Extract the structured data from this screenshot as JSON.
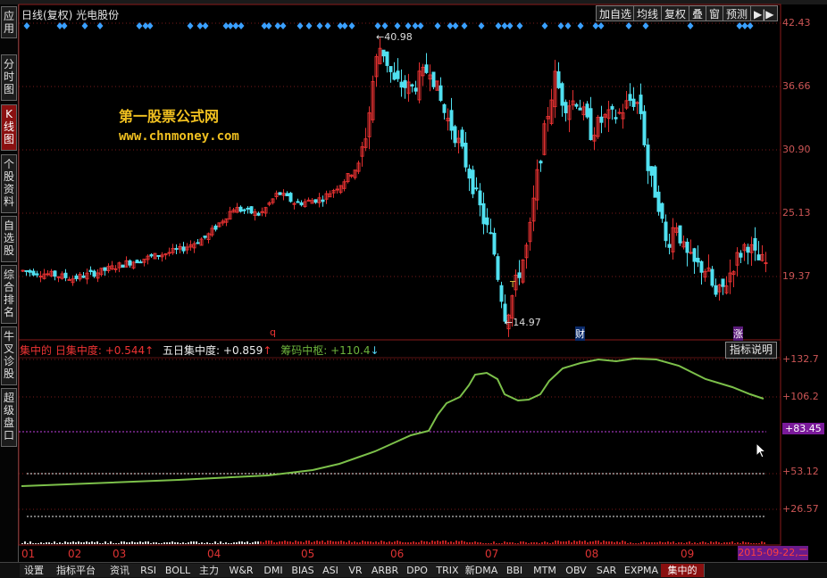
{
  "header": {
    "title": "日线(复权) 光电股份",
    "buttons": [
      "加自选",
      "均线",
      "复权",
      "叠",
      "窗",
      "预测",
      "▶|▶"
    ]
  },
  "sidebar": {
    "tabs": [
      "应用",
      "分时图",
      "K线图",
      "个股资料",
      "自选股",
      "综合排名",
      "牛叉诊股",
      "超级盘口"
    ],
    "active_index": 2
  },
  "watermark": {
    "line1": "第一股票公式网",
    "line2": "www.chnmoney.com"
  },
  "price_axis": [
    "42.43",
    "36.66",
    "30.90",
    "25.13",
    "19.37"
  ],
  "price_markers": {
    "high": "40.98",
    "low": "14.97"
  },
  "event_marks": {
    "q": "q",
    "t": "T",
    "cai": "财",
    "zhang": "涨"
  },
  "indicator": {
    "name": "集中的",
    "f1_label": "日集中度:",
    "f1_value": "+0.544",
    "f2_label": "五日集中度:",
    "f2_value": "+0.859",
    "f3_label": "筹码中枢:",
    "f3_value": "+110.4",
    "explain_button": "指标说明",
    "axis": [
      "+132.7",
      "+106.2",
      "+83.45",
      "+53.12",
      "+26.57"
    ]
  },
  "months": [
    "01",
    "02",
    "03",
    "04",
    "05",
    "06",
    "07",
    "08",
    "09"
  ],
  "date_label": "2015-09-22,二",
  "bottom_tabs": [
    "设置",
    "指标平台",
    "资讯",
    "RSI",
    "BOLL",
    "主力",
    "W&R",
    "DMI",
    "BIAS",
    "ASI",
    "VR",
    "ARBR",
    "DPO",
    "TRIX",
    "新DMA",
    "BBI",
    "MTM",
    "OBV",
    "SAR",
    "EXPMA",
    "集中的"
  ],
  "bottom_active_index": 20,
  "colors": {
    "up": "#e23030",
    "down": "#50e0f0",
    "line": "#7cc04a",
    "grid": "#7a1a1a",
    "diamond": "#3aa0ff"
  }
}
